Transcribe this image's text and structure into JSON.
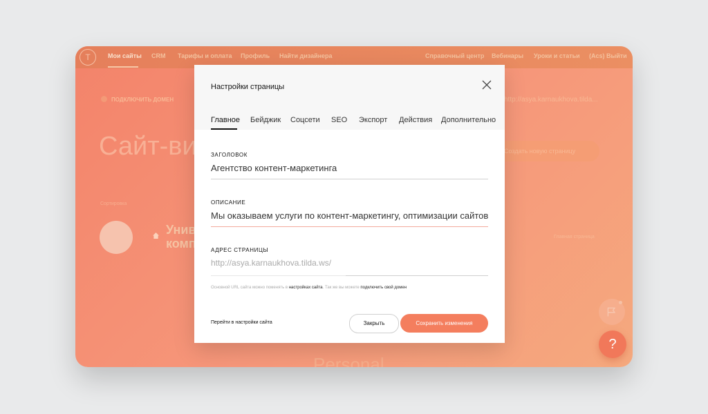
{
  "topnav": {
    "logo": "T",
    "left_items": [
      "Мои сайты",
      "CRM",
      "Тарифы и оплата",
      "Профиль",
      "Найти дизайнера"
    ],
    "right_items": [
      "Справочный центр",
      "Вебинары",
      "Уроки и статьи"
    ],
    "account": "(Acs) Выйти"
  },
  "background": {
    "connect_domain": "ПОДКЛЮЧИТЬ ДОМЕН",
    "site_url": "http://asya.karnaukhova.tilda...",
    "site_title": "Сайт-виз",
    "add_page_button": "Создать новую страницу",
    "small_label": "Сортировка",
    "page_card_title_line1": "Унив",
    "page_card_title_line2": "комп",
    "home_page_label": "Главная страница",
    "personal_text": "Personal"
  },
  "modal": {
    "title": "Настройки страницы",
    "tabs": [
      "Главное",
      "Бейджик",
      "Соцсети",
      "SEO",
      "Экспорт",
      "Действия",
      "Дополнительно"
    ],
    "active_tab": "Главное",
    "fields": {
      "title_label": "ЗАГОЛОВОК",
      "title_value": "Агентство контент-маркетинга",
      "desc_label": "ОПИСАНИЕ",
      "desc_value": "Мы оказываем услуги по контент-маркетингу, оптимизации сайтов,",
      "address_label": "АДРЕС СТРАНИЦЫ",
      "address_prefix": "http://asya.karnaukhova.tilda.ws/",
      "address_value": ""
    },
    "hint": {
      "part1": "Основной URL сайта можно поменять в",
      "link1": "настройках сайта",
      "part2": ". Так же вы можете",
      "link2": "подключить свой домен"
    },
    "goto_settings": "Перейти в настройки сайта",
    "close_button": "Закрыть",
    "save_button": "Сохранить изменения"
  },
  "fab": {
    "help_symbol": "?"
  },
  "icons": {
    "close": "close-icon",
    "home": "home-icon",
    "flag": "flag-icon",
    "help": "help-icon"
  },
  "colors": {
    "accent": "#f47e5e",
    "background_gradient_start": "#f3836a",
    "background_gradient_end": "#f5a97e"
  }
}
